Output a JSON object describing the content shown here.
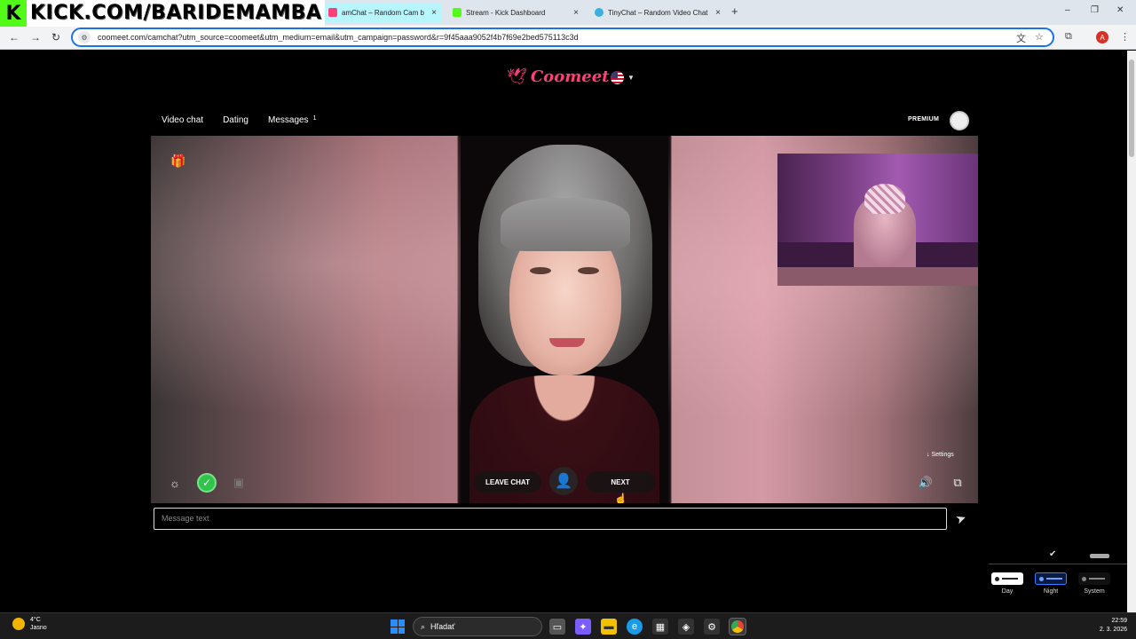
{
  "overlay": {
    "kick_logo": "K",
    "kick_text": "KICK.COM/BARIDEMAMBA"
  },
  "browser": {
    "tabs": [
      {
        "label": "amChat – Random Cam b",
        "close": "×",
        "active": true
      },
      {
        "label": "Stream - Kick Dashboard",
        "close": "×",
        "active": false
      },
      {
        "label": "TinyChat – Random Video Chat",
        "close": "×",
        "active": false
      }
    ],
    "new_tab": "+",
    "window_controls": {
      "minimize": "–",
      "maximize": "❐",
      "close": "✕"
    },
    "nav": {
      "back": "←",
      "forward": "→",
      "reload": "↻"
    },
    "url": "coomeet.com/camchat?utm_source=coomeet&utm_medium=email&utm_campaign=password&r=9f45aaa9052f4b7f69e2bed575113c3d",
    "profile_letter": "A"
  },
  "site": {
    "brand": "Coomeet",
    "nav": [
      {
        "label": "Video chat"
      },
      {
        "label": "Dating"
      },
      {
        "label": "Messages",
        "badge": "1"
      }
    ],
    "premium_label": "PREMIUM",
    "settings_link": "↓ Settings",
    "leave_chat": "LEAVE CHAT",
    "next": "NEXT",
    "message_placeholder": "Message text",
    "themes": [
      {
        "label": "Day"
      },
      {
        "label": "Night"
      },
      {
        "label": "System"
      }
    ],
    "theme_check": "✔"
  },
  "taskbar": {
    "weather_temp": "4°C",
    "weather_desc": "Jasno",
    "search_label": "Hľadať",
    "time": "22:59",
    "date": "2. 3. 2026"
  }
}
